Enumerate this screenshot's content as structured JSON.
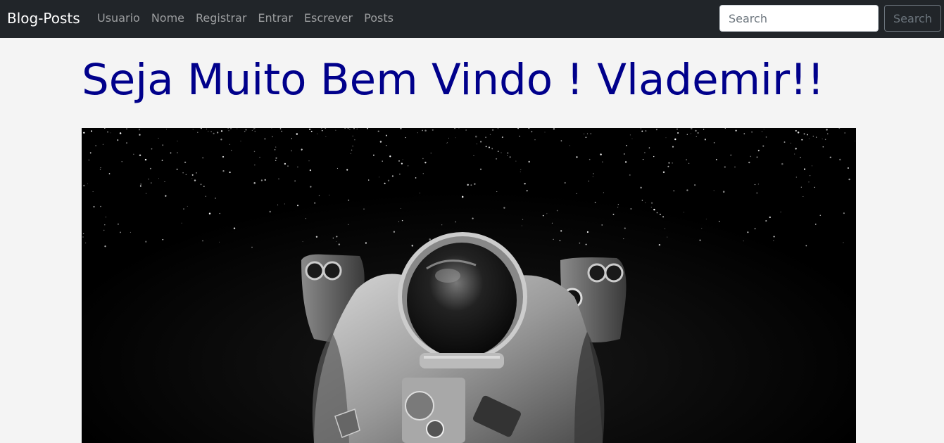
{
  "navbar": {
    "brand": "Blog-Posts",
    "links": [
      {
        "label": "Usuario"
      },
      {
        "label": "Nome"
      },
      {
        "label": "Registrar"
      },
      {
        "label": "Entrar"
      },
      {
        "label": "Escrever"
      },
      {
        "label": "Posts"
      }
    ],
    "search": {
      "placeholder": "Search",
      "value": "",
      "button_label": "Search"
    }
  },
  "main": {
    "welcome_title": "Seja Muito Bem Vindo ! Vlademir!!",
    "hero_image_subject": "astronaut-in-space"
  },
  "colors": {
    "navbar_bg": "#212529",
    "title_color": "#00008b",
    "page_bg": "#f4f4f4"
  }
}
